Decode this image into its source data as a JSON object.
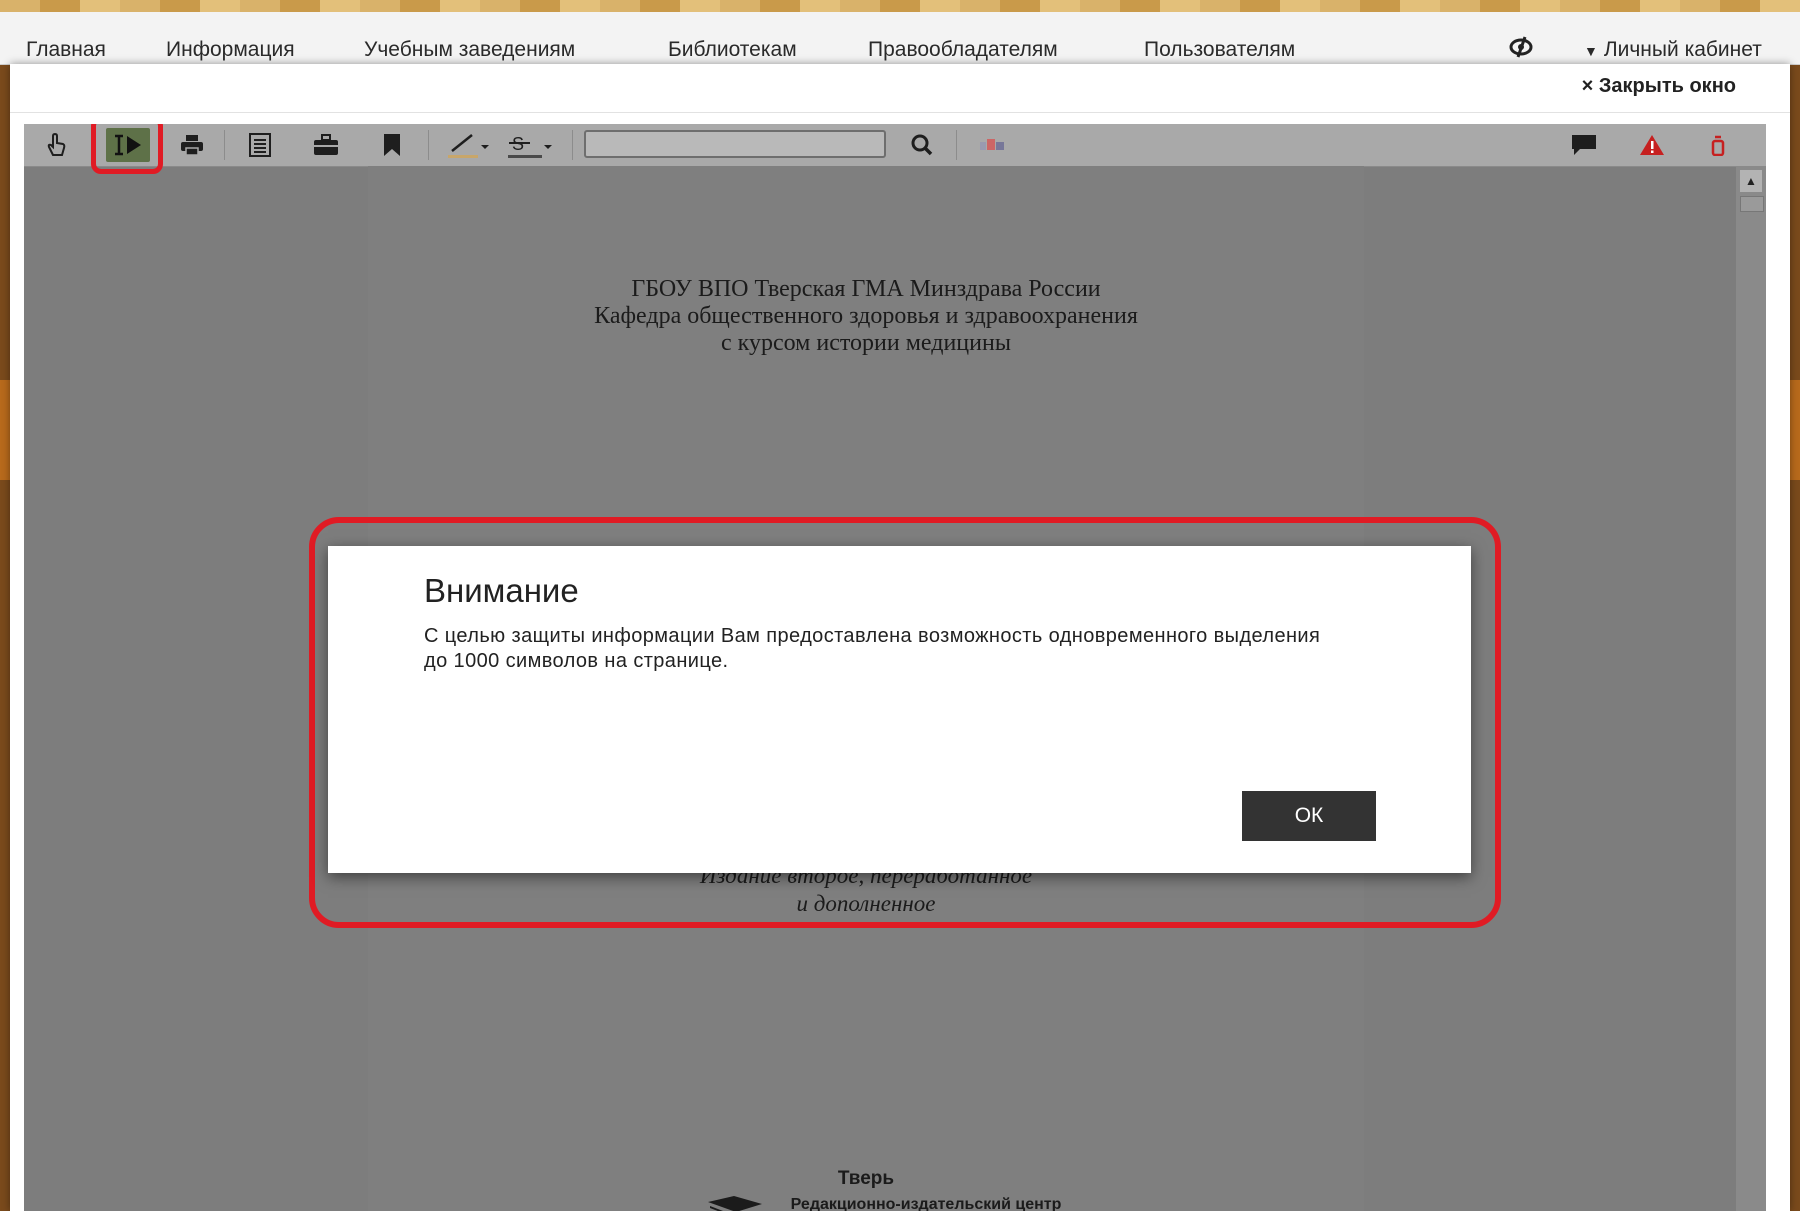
{
  "nav": {
    "items": [
      "Главная",
      "Информация",
      "Учебным заведениям",
      "Библиотекам",
      "Правообладателям",
      "Пользователям"
    ],
    "cabinet": "Личный кабинет"
  },
  "window": {
    "close_label": "× Закрыть окно"
  },
  "toolbar": {
    "tools": [
      "hand-tool",
      "text-select-tool",
      "print",
      "page-view",
      "briefcase",
      "bookmark",
      "highlighter",
      "strikethrough",
      "search",
      "color-picker",
      "comment",
      "warning",
      "extension"
    ],
    "search_value": "",
    "accent_color": "#e01b24"
  },
  "document": {
    "header_lines": [
      "ГБОУ ВПО Тверская ГМА Минздрава России",
      "Кафедра общественного здоровья и здравоохранения",
      "с курсом истории медицины"
    ],
    "edition_lines": [
      "Издание второе, переработанное",
      "и дополненное"
    ],
    "city": "Тверь",
    "publisher": "Редакционно-издательский центр"
  },
  "dialog": {
    "title": "Внимание",
    "message": "С целью защиты информации Вам предоставлена возможность одновременного выделения до 1000 символов на странице.",
    "ok_label": "ОК"
  }
}
